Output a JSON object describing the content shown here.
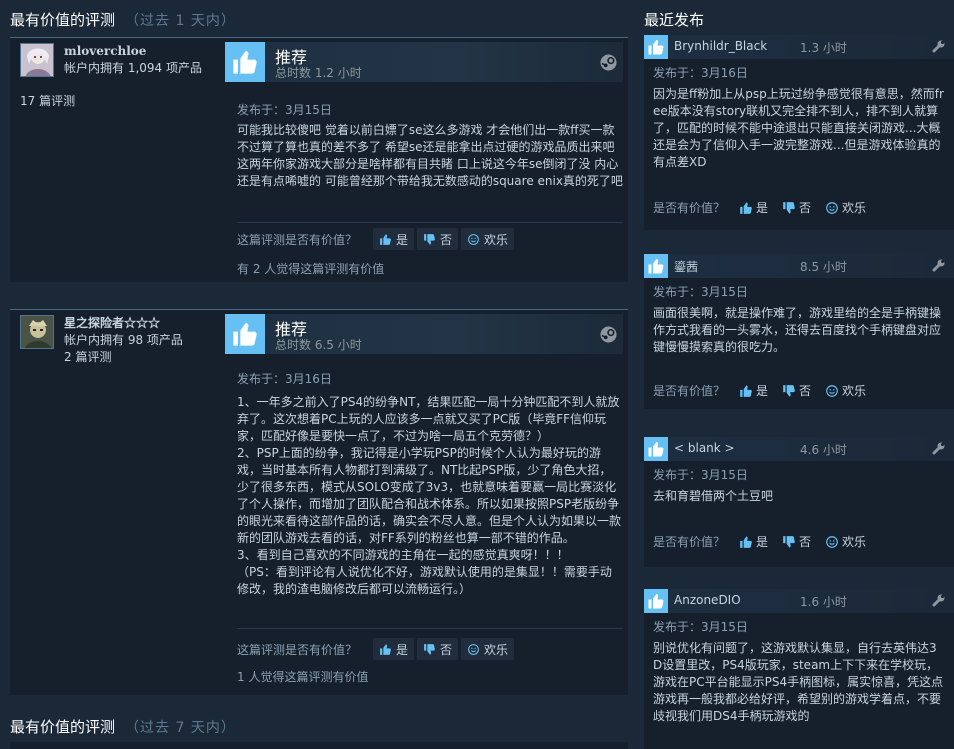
{
  "left_section": {
    "title": "最有价值的评测",
    "subtitle": "（过去 1 天内）"
  },
  "right_section": {
    "title": "最近发布"
  },
  "bottom_section": {
    "title": "最有价值的评测",
    "subtitle": "（过去 7 天内）"
  },
  "reviews": [
    {
      "author_name": "mloverchloe",
      "author_products": "帐户内拥有 1,094 项产品",
      "author_reviews": "17 篇评测",
      "recommendation": "推荐",
      "hours": "总时数 1.2 小时",
      "posted": "发布于：3月15日",
      "body": "可能我比较傻吧 觉着以前白嫖了se这么多游戏 才会他们出一款ff买一款 不过算了算也真的差不多了 希望se还是能拿出点过硬的游戏品质出来吧 这两年你家游戏大部分是啥样都有目共睹 口上说这今年se倒闭了没 内心还是有点唏嘘的 可能曾经那个带给我无数感动的square enix真的死了吧",
      "helpful_q": "这篇评测是否有价值？",
      "btn_yes": "是",
      "btn_no": "否",
      "btn_funny": "欢乐",
      "helpful_count": "有 2 人觉得这篇评测有价值"
    },
    {
      "author_name": "星之探险者☆☆☆",
      "author_products": "帐户内拥有 98 项产品",
      "author_reviews": "2 篇评测",
      "recommendation": "推荐",
      "hours": "总时数 6.5 小时",
      "posted": "发布于：3月16日",
      "body": "1、一年多之前入了PS4的纷争NT，结果匹配一局十分钟匹配不到人就放弃了。这次想着PC上玩的人应该多一点就又买了PC版（毕竟FF信仰玩家，匹配好像是要快一点了，不过为啥一局五个克劳德？）\n2、PSP上面的纷争，我记得是小学玩PSP的时候个人认为最好玩的游戏，当时基本所有人物都打到满级了。NT比起PSP版，少了角色大招，少了很多东西，模式从SOLO变成了3v3，也就意味着要赢一局比赛淡化了个人操作，而增加了团队配合和战术体系。所以如果按照PSP老版纷争的眼光来看待这部作品的话，确实会不尽人意。但是个人认为如果以一款新的团队游戏去看的话，对FF系列的粉丝也算一部不错的作品。\n3、看到自己喜欢的不同游戏的主角在一起的感觉真爽呀！！！\n（PS：看到评论有人说优化不好，游戏默认使用的是集显！！需要手动修改，我的渣电脑修改后都可以流畅运行。）",
      "helpful_q": "这篇评测是否有价值？",
      "btn_yes": "是",
      "btn_no": "否",
      "btn_funny": "欢乐",
      "helpful_count": "1 人觉得这篇评测有价值"
    }
  ],
  "recent": [
    {
      "name": "Brynhildr_Black",
      "time": "1.3 小时",
      "posted": "发布于：3月16日",
      "text": "因为是ff粉加上从psp上玩过纷争感觉很有意思，然而free版本没有story联机又完全排不到人，排不到人就算了，匹配的时候不能中途退出只能直接关闭游戏...大概还是会为了信仰入手一波完整游戏...但是游戏体验真的有点差XD",
      "helpful_q": "是否有价值？",
      "btn_yes": "是",
      "btn_no": "否",
      "btn_funny": "欢乐"
    },
    {
      "name": "鎏茜",
      "time": "8.5 小时",
      "posted": "发布于：3月15日",
      "text": "画面很美啊，就是操作难了，游戏里给的全是手柄键操作方式我看的一头雾水，还得去百度找个手柄键盘对应键慢慢摸索真的很吃力。",
      "helpful_q": "是否有价值？",
      "btn_yes": "是",
      "btn_no": "否",
      "btn_funny": "欢乐"
    },
    {
      "name": "< blank >",
      "time": "4.6 小时",
      "posted": "发布于：3月15日",
      "text": "去和育碧借两个土豆吧",
      "helpful_q": "是否有价值？",
      "btn_yes": "是",
      "btn_no": "否",
      "btn_funny": "欢乐"
    },
    {
      "name": "AnzoneDIO",
      "time": "1.6 小时",
      "posted": "发布于：3月15日",
      "text": "别说优化有问题了，这游戏默认集显，自行去英伟达3D设置里改，PS4版玩家，steam上下下来在学校玩，游戏在PC平台能显示PS4手柄图标，属实惊喜，凭这点游戏再一般我都必给好评，希望别的游戏学着点，不要歧视我们用DS4手柄玩游戏的"
    }
  ],
  "colors": {
    "background": "#1b2838",
    "accent": "#66c0f4",
    "card": "#16202d"
  }
}
